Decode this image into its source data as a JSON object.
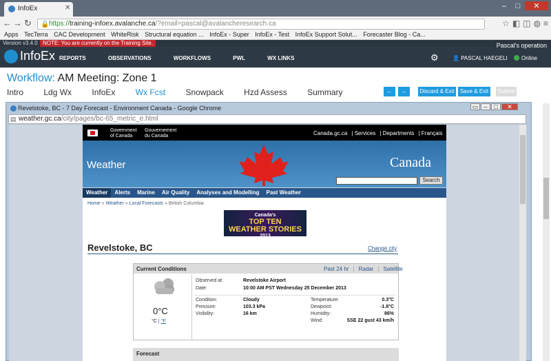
{
  "browser": {
    "tab_title": "InfoEx",
    "url_scheme": "https://",
    "url_host": "training-infoex.avalanche.ca",
    "url_rest": "/?email=pascal@avalancheresearch.ca",
    "bookmarks": [
      "Apps",
      "TecTerra",
      "CAC Development",
      "WhiteRisk",
      "Structural equation ...",
      "InfoEx - Super",
      "InfoEx - Test",
      "InfoEx Support Solut...",
      "Forecaster Blog - Ca..."
    ]
  },
  "infoex": {
    "version": "Version v3.4.0",
    "notice": "NOTE: You are currently on the Training Site.",
    "operation": "Pascal's operation",
    "logo": "InfoEx",
    "menu": [
      "REPORTS",
      "OBSERVATIONS",
      "WORKFLOWS",
      "PWL",
      "WX LINKS"
    ],
    "user": "PASCAL HAEGELI",
    "status": "Online"
  },
  "workflow": {
    "label": "Workflow:",
    "name": "AM Meeting: Zone 1",
    "tabs": [
      "Intro",
      "Ldg Wx",
      "InfoEx",
      "Wx Fcst",
      "Snowpack",
      "Hzd Assess",
      "Summary"
    ],
    "active_tab": "Wx Fcst",
    "discard": "Discard & Exit",
    "save": "Save & Exit",
    "submit": "Submit",
    "prev": "←",
    "next": "→"
  },
  "popup": {
    "title": "Revelstoke, BC - 7 Day Forecast - Environment Canada - Google Chrome",
    "url_domain": "weather.gc.ca",
    "url_path": "/city/pages/bc-65_metric_e.html"
  },
  "gc": {
    "gov_en": [
      "Government",
      "of Canada"
    ],
    "gov_fr": [
      "Gouvernement",
      "du Canada"
    ],
    "links": [
      "Canada.gc.ca",
      "Services",
      "Departments",
      "Français"
    ],
    "weather": "Weather",
    "canada": "Canada",
    "search_btn": "Search",
    "nav": [
      "Weather",
      "Alerts",
      "Marine",
      "Air Quality",
      "Analyses and Modelling",
      "Past Weather"
    ],
    "breadcrumb": [
      "Home",
      "Weather",
      "Local Forecasts",
      "British Columbia"
    ],
    "ad": [
      "Canada's",
      "TOP TEN",
      "WEATHER STORIES",
      "2013"
    ],
    "city": "Revelstoke, BC",
    "change_city": "Change city"
  },
  "conditions": {
    "title": "Current Conditions",
    "links": [
      "Past 24 hr",
      "Radar",
      "Satellite"
    ],
    "temp": "0°C",
    "unit_c": "°C",
    "unit_f": "°F",
    "observed_label": "Observed at:",
    "observed": "Revelstoke Airport",
    "date_label": "Date:",
    "date": "10:00 AM PST Wednesday 25 December 2013",
    "condition_label": "Condition:",
    "condition": "Cloudy",
    "pressure_label": "Pressure:",
    "pressure": "103.3 kPa",
    "visibility_label": "Visibility:",
    "visibility": "16 km",
    "temperature_label": "Temperature:",
    "temperature": "0.3°C",
    "dewpoint_label": "Dewpoint:",
    "dewpoint": "-1.8°C",
    "humidity_label": "Humidity:",
    "humidity": "86%",
    "wind_label": "Wind:",
    "wind": "SSE 22 gust 43 km/h"
  },
  "forecast": {
    "title": "Forecast"
  },
  "colors": {
    "accent": "#1f9be0",
    "header": "#2d3a46",
    "gc_blue": "#29568a"
  }
}
